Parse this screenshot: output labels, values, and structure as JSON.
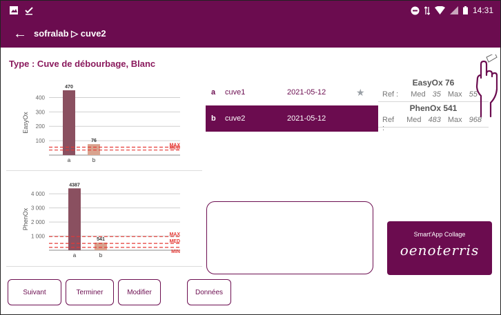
{
  "status": {
    "time": "14:31"
  },
  "appbar": {
    "title": "sofralab ▷ cuve2"
  },
  "type_line": "Type : Cuve de débourbage, Blanc",
  "colors": {
    "brand": "#6b0c4f",
    "bar_a": "#8a5060",
    "bar_b": "#d9a38e",
    "threshold": "#e53935"
  },
  "charts": [
    {
      "chart_data": {
        "type": "bar",
        "ylabel": "EasyOx",
        "categories": [
          "a",
          "b"
        ],
        "values": [
          470,
          76
        ],
        "value_labels": [
          "470",
          "76"
        ],
        "ylim": [
          0,
          450
        ],
        "ticks": [
          100,
          200,
          300,
          400
        ],
        "tick_labels": [
          "100",
          "200",
          "300",
          "400"
        ],
        "thresholds": [
          {
            "name": "MAX",
            "value": 55
          },
          {
            "name": "MED",
            "value": 35
          }
        ],
        "grid": true
      }
    },
    {
      "chart_data": {
        "type": "bar",
        "ylabel": "PhenOx",
        "categories": [
          "a",
          "b"
        ],
        "values": [
          4387,
          541
        ],
        "value_labels": [
          "4387",
          "541"
        ],
        "ylim": [
          0,
          4400
        ],
        "ticks": [
          1000,
          2000,
          3000,
          4000
        ],
        "tick_labels": [
          "1 000",
          "2 000",
          "3 000",
          "4 000"
        ],
        "thresholds": [
          {
            "name": "MAX",
            "value": 968
          },
          {
            "name": "MED",
            "value": 483
          },
          {
            "name": "MIN",
            "value": 200
          }
        ],
        "grid": true
      }
    }
  ],
  "samples": [
    {
      "letter": "a",
      "name": "cuve1",
      "date": "2021-05-12",
      "starred": true,
      "selected": false
    },
    {
      "letter": "b",
      "name": "cuve2",
      "date": "2021-05-12",
      "starred": false,
      "selected": true
    }
  ],
  "stats": [
    {
      "title": "EasyOx 76",
      "ref": "Ref :",
      "med_label": "Med",
      "med": "35",
      "max_label": "Max",
      "max": "55"
    },
    {
      "title": "PhenOx 541",
      "ref": "Ref :",
      "med_label": "Med",
      "med": "483",
      "max_label": "Max",
      "max": "968"
    }
  ],
  "brand": {
    "subtitle": "Smart'App Collage",
    "logo": "oenoterris"
  },
  "buttons": {
    "next": "Suivant",
    "finish": "Terminer",
    "edit": "Modifier",
    "data": "Données"
  }
}
